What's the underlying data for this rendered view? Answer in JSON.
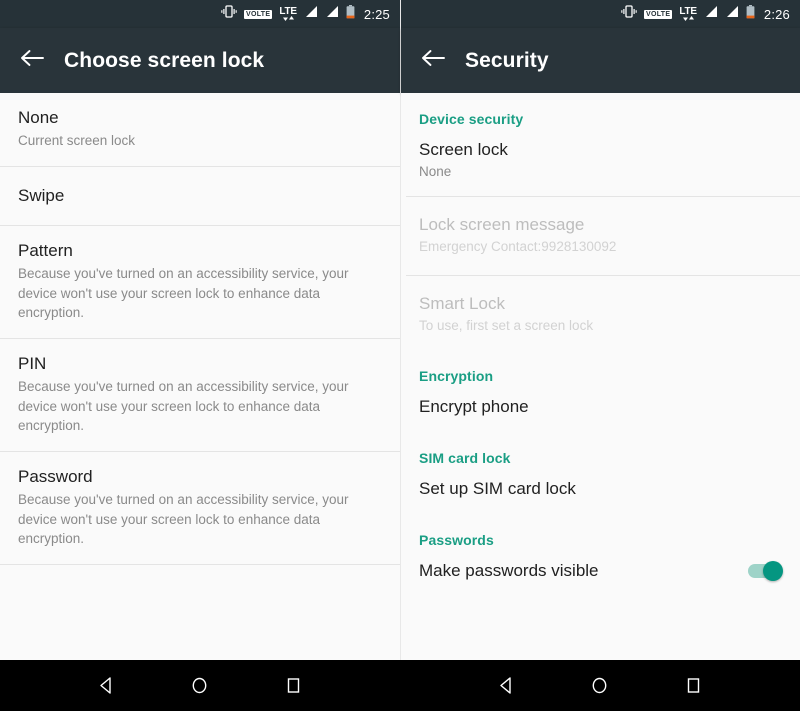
{
  "left_screen": {
    "statusbar": {
      "time": "2:25",
      "icons": [
        "vibrate-icon",
        "volte-icon",
        "lte-icon",
        "signal-sim1-icon",
        "signal-sim2-icon",
        "battery-icon"
      ],
      "volte_label": "VOLTE",
      "lte_label": "LTE"
    },
    "actionbar": {
      "back_icon": "back-arrow-icon",
      "title": "Choose screen lock"
    },
    "accessibility_note": "Because you've turned on an accessibility service, your device won't use your screen lock to enhance data encryption.",
    "items": [
      {
        "title": "None",
        "sub": "Current screen lock"
      },
      {
        "title": "Swipe",
        "sub": ""
      },
      {
        "title": "Pattern",
        "sub": "Because you've turned on an accessibility service, your device won't use your screen lock to enhance data encryption."
      },
      {
        "title": "PIN",
        "sub": "Because you've turned on an accessibility service, your device won't use your screen lock to enhance data encryption."
      },
      {
        "title": "Password",
        "sub": "Because you've turned on an accessibility service, your device won't use your screen lock to enhance data encryption."
      }
    ]
  },
  "right_screen": {
    "statusbar": {
      "time": "2:26",
      "icons": [
        "vibrate-icon",
        "volte-icon",
        "lte-icon",
        "signal-sim1-icon",
        "signal-sim2-icon",
        "battery-icon"
      ],
      "volte_label": "VOLTE",
      "lte_label": "LTE"
    },
    "actionbar": {
      "back_icon": "back-arrow-icon",
      "title": "Security"
    },
    "sections": [
      {
        "header": "Device security",
        "items": [
          {
            "title": "Screen lock",
            "sub": "None",
            "disabled": false
          },
          {
            "title": "Lock screen message",
            "sub": "Emergency Contact:9928130092",
            "disabled": true
          },
          {
            "title": "Smart Lock",
            "sub": "To use, first set a screen lock",
            "disabled": true
          }
        ]
      },
      {
        "header": "Encryption",
        "items": [
          {
            "title": "Encrypt phone",
            "sub": "",
            "disabled": false
          }
        ]
      },
      {
        "header": "SIM card lock",
        "items": [
          {
            "title": "Set up SIM card lock",
            "sub": "",
            "disabled": false
          }
        ]
      },
      {
        "header": "Passwords",
        "items": [
          {
            "title": "Make passwords visible",
            "sub": "",
            "disabled": false,
            "toggle": "on"
          }
        ]
      }
    ]
  },
  "navbar": {
    "buttons": [
      "back-triangle-icon",
      "home-circle-icon",
      "recents-square-icon"
    ]
  },
  "colors": {
    "accent_teal": "#1a9e84",
    "toggle_on": "#059681",
    "actionbar": "#29343a",
    "statusbar": "#263238",
    "background": "#fafafa"
  }
}
